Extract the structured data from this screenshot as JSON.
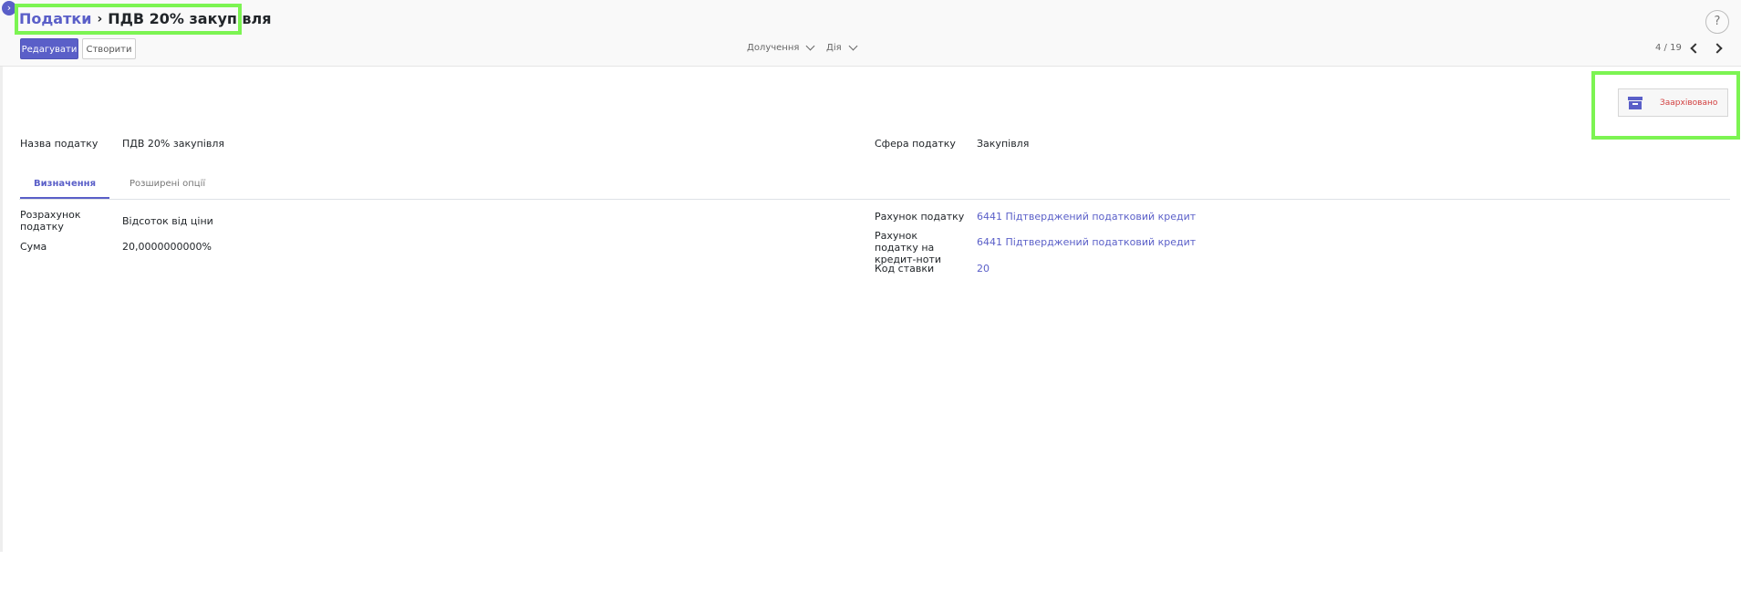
{
  "breadcrumb": {
    "parent": "Податки",
    "separator": "›",
    "current": "ПДВ 20% закупівля"
  },
  "toolbar": {
    "edit_label": "Редагувати",
    "create_label": "Створити",
    "attachments_label": "Долучення",
    "action_label": "Дія"
  },
  "pager": {
    "value": "4 / 19"
  },
  "help": {
    "label": "?"
  },
  "status": {
    "archived_label": "Заархівовано"
  },
  "form": {
    "tax_name_label": "Назва податку",
    "tax_name_value": "ПДВ 20% закупівля",
    "tax_scope_label": "Сфера податку",
    "tax_scope_value": "Закупівля"
  },
  "tabs": [
    {
      "label": "Визначення"
    },
    {
      "label": "Розширені опції"
    }
  ],
  "definition": {
    "computation_label": "Розрахунок податку",
    "computation_value": "Відсоток від ціни",
    "amount_label": "Сума",
    "amount_value": "20,0000000000%",
    "account_label": "Рахунок податку",
    "account_value": "6441 Підтверджений податковий кредит",
    "refund_account_label": "Рахунок податку на кредит-ноти",
    "refund_account_value": "6441 Підтверджений податковий кредит",
    "rate_code_label": "Код ставки",
    "rate_code_value": "20"
  },
  "colors": {
    "accent": "#5a5fc8",
    "archived": "#d23f3f",
    "highlight": "#7cf452"
  }
}
